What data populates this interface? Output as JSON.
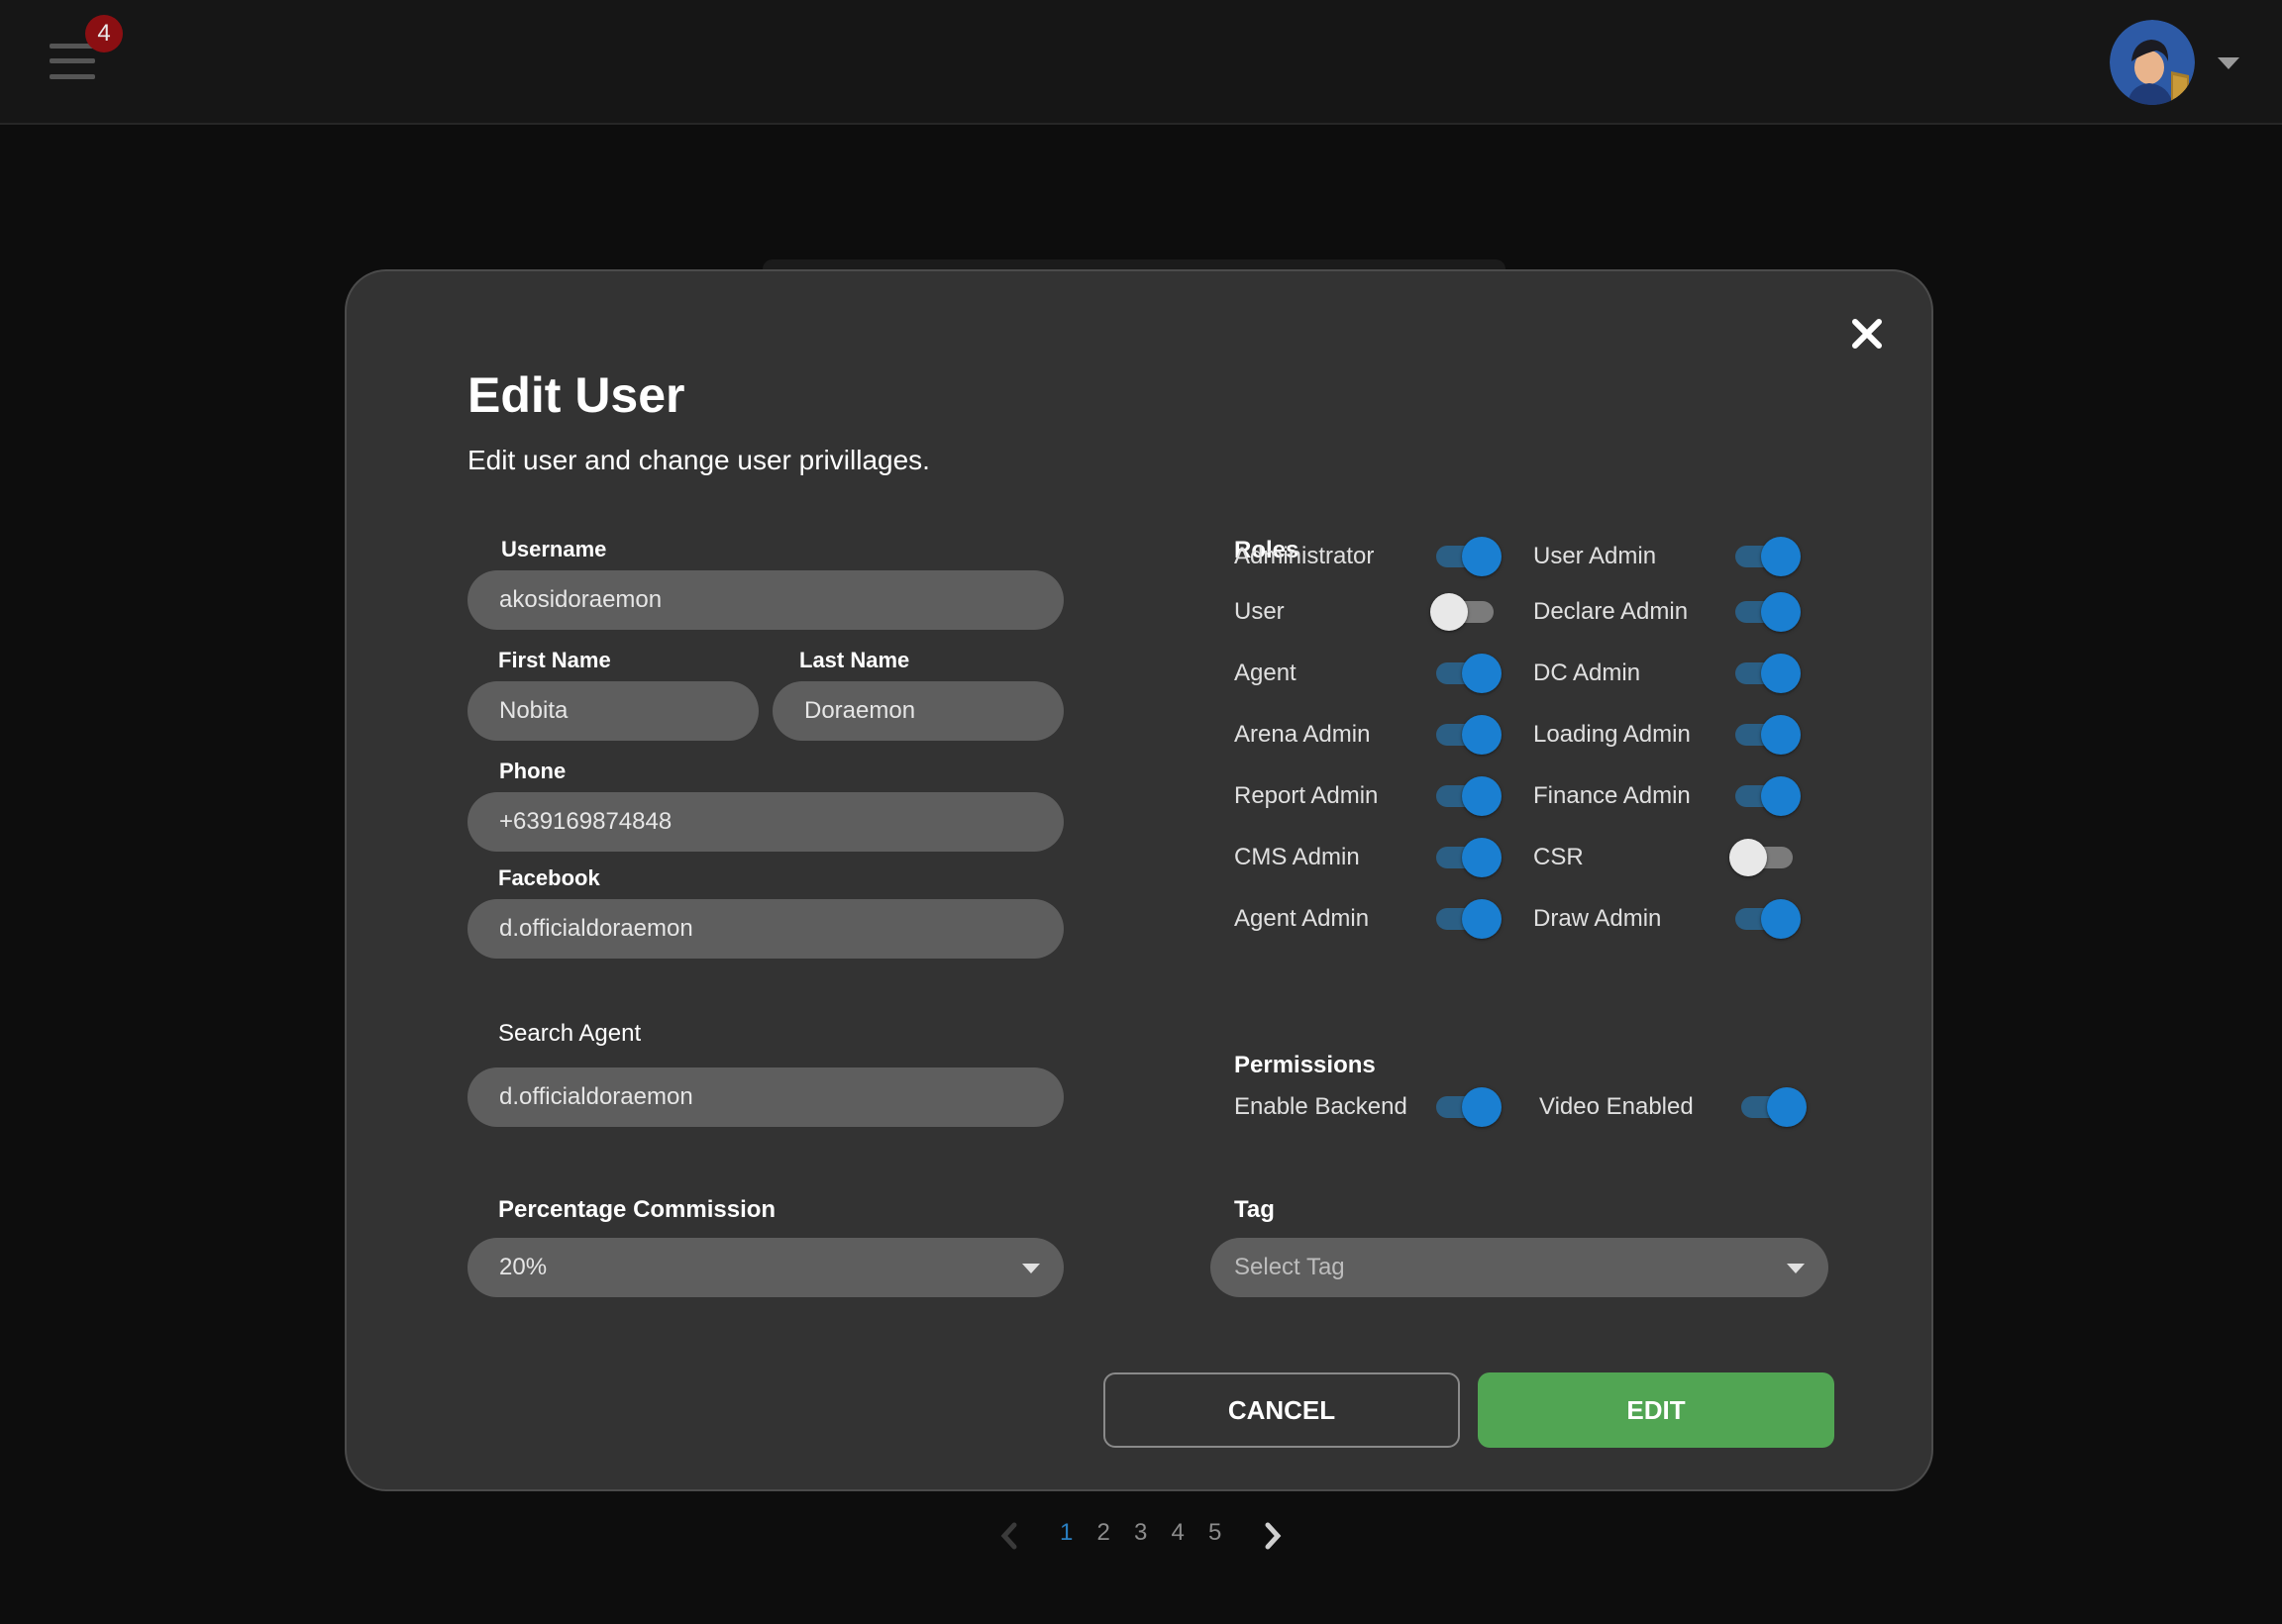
{
  "header": {
    "notification_count": "4",
    "menu_icon": "hamburger-menu-icon",
    "avatar_icon": "user-avatar-icon",
    "account_caret_icon": "caret-down-icon"
  },
  "modal": {
    "title": "Edit User",
    "subtitle": "Edit user and change user privillages.",
    "close_icon": "close-icon",
    "fields": {
      "username": {
        "label": "Username",
        "value": "akosidoraemon"
      },
      "first_name": {
        "label": "First Name",
        "value": "Nobita"
      },
      "last_name": {
        "label": "Last Name",
        "value": "Doraemon"
      },
      "phone": {
        "label": "Phone",
        "value": "+639169874848"
      },
      "facebook": {
        "label": "Facebook",
        "value": "d.officialdoraemon"
      },
      "search_agent": {
        "label": "Search Agent",
        "value": "d.officialdoraemon"
      },
      "commission": {
        "label": "Percentage Commission",
        "value": "20%"
      },
      "tag": {
        "label": "Tag",
        "placeholder": "Select Tag"
      }
    },
    "roles": {
      "heading": "Roles",
      "items": [
        {
          "label": "Administrator",
          "on": true
        },
        {
          "label": "User Admin",
          "on": true
        },
        {
          "label": "User",
          "on": false
        },
        {
          "label": "Declare Admin",
          "on": true
        },
        {
          "label": "Agent",
          "on": true
        },
        {
          "label": "DC Admin",
          "on": true
        },
        {
          "label": "Arena Admin",
          "on": true
        },
        {
          "label": "Loading Admin",
          "on": true
        },
        {
          "label": "Report Admin",
          "on": true
        },
        {
          "label": "Finance Admin",
          "on": true
        },
        {
          "label": "CMS Admin",
          "on": true
        },
        {
          "label": "CSR",
          "on": false
        },
        {
          "label": "Agent Admin",
          "on": true
        },
        {
          "label": "Draw Admin",
          "on": true
        }
      ]
    },
    "permissions": {
      "heading": "Permissions",
      "items": [
        {
          "label": "Enable Backend",
          "on": true
        },
        {
          "label": "Video Enabled",
          "on": true
        }
      ]
    },
    "buttons": {
      "cancel": "CANCEL",
      "edit": "EDIT"
    }
  },
  "pagination": {
    "pages": [
      "1",
      "2",
      "3",
      "4",
      "5"
    ],
    "current": "1",
    "prev_icon": "chevron-left-icon",
    "next_icon": "chevron-right-icon"
  },
  "colors": {
    "accent": "#1a7fd1",
    "primary_button": "#51a553",
    "badge": "#8b0f12",
    "modal_bg": "#333333"
  }
}
